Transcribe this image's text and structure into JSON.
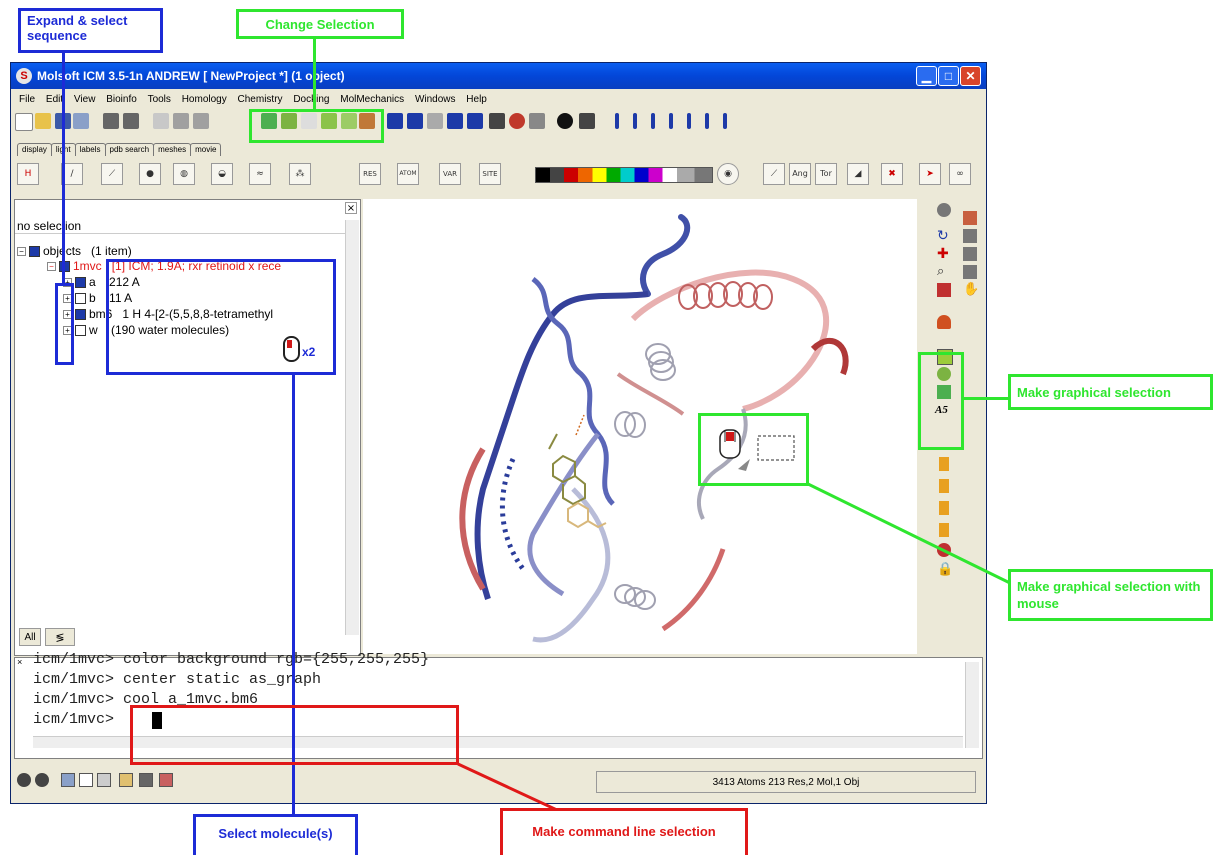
{
  "app": {
    "title": "Molsoft ICM 3.5-1n ANDREW [ NewProject *] (1 object)",
    "app_icon_glyph": "S"
  },
  "menu": [
    "File",
    "Edit",
    "View",
    "Bioinfo",
    "Tools",
    "Homology",
    "Chemistry",
    "Docking",
    "MolMechanics",
    "Windows",
    "Help"
  ],
  "tabs": [
    "display",
    "light",
    "labels",
    "pdb search",
    "meshes",
    "movie"
  ],
  "toolbar2_labels": {
    "res": "RES",
    "atom": "ATOM",
    "var": "VAR",
    "site": "SITE",
    "ang": "Ang",
    "tor": "Tor"
  },
  "left_panel": {
    "selection_text": "no selection",
    "objects_label": "objects",
    "objects_count": "(1 item)",
    "object_name": "1mvc",
    "object_desc": "[1] ICM; 1.9A; rxr retinoid x rece",
    "rows": [
      {
        "name": "a",
        "info": "212 A",
        "checked": true
      },
      {
        "name": "b",
        "info": "11 A",
        "checked": false
      },
      {
        "name": "bm6",
        "info": "1 H  4-[2-(5,5,8,8-tetramethyl",
        "checked": true
      },
      {
        "name": "w",
        "info": "(190 water molecules)",
        "checked": false
      }
    ],
    "tab_all": "All",
    "x2_label": "x2"
  },
  "console": {
    "lines": [
      "icm/1mvc> color background rgb={255,255,255}",
      "icm/1mvc> center static as_graph",
      "icm/1mvc> cool a_1mvc.bm6",
      "icm/1mvc> "
    ]
  },
  "status": {
    "text": "3413 Atoms 213 Res,2 Mol,1 Obj"
  },
  "callouts": {
    "expand": "Expand & select sequence",
    "change": "Change Selection",
    "graphical": "Make graphical selection",
    "graphical_mouse": "Make graphical selection with mouse",
    "molecule": "Select molecule(s)",
    "command": "Make command line selection"
  },
  "colors": {
    "blue": "#1d2bd6",
    "green": "#2fe62f",
    "red": "#e01818",
    "title_blue": "#0346d8"
  }
}
